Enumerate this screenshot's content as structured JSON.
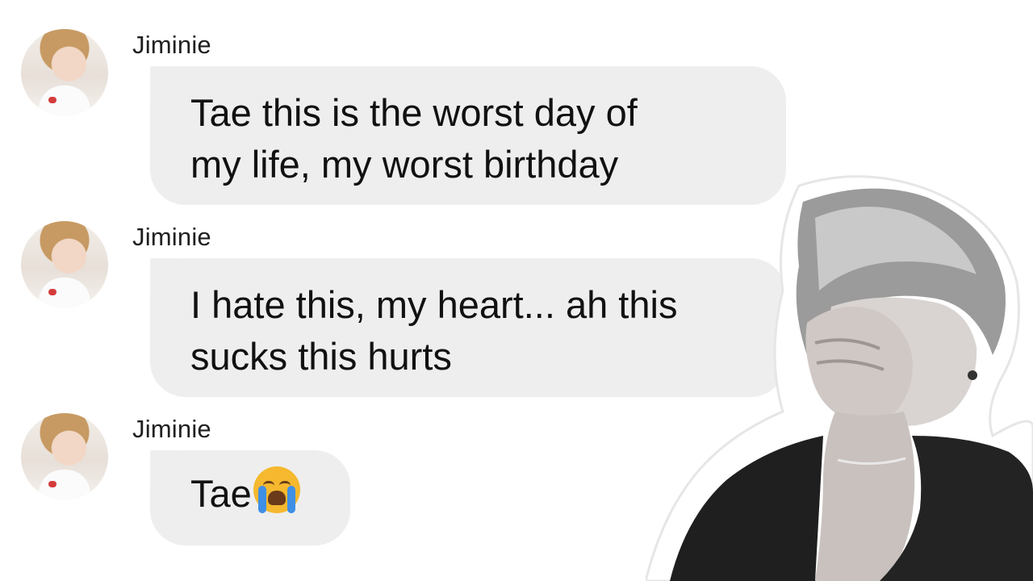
{
  "messages": [
    {
      "sender": "Jiminie",
      "lines": [
        "Tae this is the worst day of",
        "my life, my worst birthday"
      ]
    },
    {
      "sender": "Jiminie",
      "lines": [
        "I hate this, my heart... ah this",
        "sucks this hurts"
      ]
    },
    {
      "sender": "Jiminie",
      "text": "Tae",
      "emoji": "loudly-crying-face-icon"
    }
  ],
  "colors": {
    "bubble": "#eeeeee",
    "text": "#111111",
    "background": "#ffffff"
  }
}
